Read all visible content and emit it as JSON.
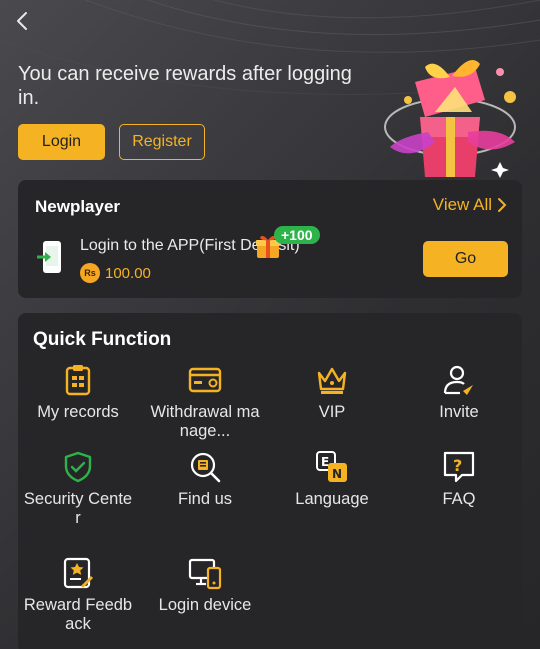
{
  "hero": {
    "message": "You can receive rewards after logging in.",
    "login_label": "Login",
    "register_label": "Register"
  },
  "newplayer": {
    "title": "Newplayer",
    "view_all": "View All",
    "task_title": "Login to the APP(First Deposit)",
    "reward_currency": "Rs",
    "reward_amount": "100.00",
    "bonus_badge": "+100",
    "go_label": "Go"
  },
  "quick_function": {
    "title": "Quick Function",
    "items": [
      {
        "label": "My records",
        "icon": "records-icon"
      },
      {
        "label": "Withdrawal manage...",
        "icon": "withdraw-card-icon"
      },
      {
        "label": "VIP",
        "icon": "crown-icon"
      },
      {
        "label": "Invite",
        "icon": "invite-user-icon"
      },
      {
        "label": "Security Center",
        "icon": "shield-check-icon"
      },
      {
        "label": "Find us",
        "icon": "search-doc-icon"
      },
      {
        "label": "Language",
        "icon": "language-icon"
      },
      {
        "label": "FAQ",
        "icon": "faq-icon"
      },
      {
        "label": "Reward Feedback",
        "icon": "feedback-icon"
      },
      {
        "label": "Login device",
        "icon": "device-icon"
      }
    ]
  },
  "colors": {
    "accent": "#f5b324",
    "card_bg": "#262628",
    "badge_green": "#2db34a",
    "icon_green": "#2db34a"
  }
}
